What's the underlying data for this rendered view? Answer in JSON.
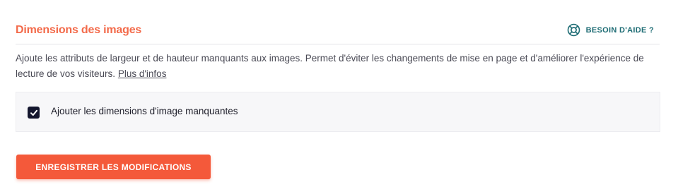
{
  "section": {
    "title": "Dimensions des images",
    "help_label": "BESOIN D'AIDE ?"
  },
  "description": {
    "text": "Ajoute les attributs de largeur et de hauteur manquants aux images. Permet d'éviter les changements de mise en page et d'améliorer l'expérience de lecture de vos visiteurs.",
    "link_label": "Plus d'infos"
  },
  "option": {
    "label": "Ajouter les dimensions d'image manquantes",
    "checked": true
  },
  "actions": {
    "save_label": "ENREGISTRER LES MODIFICATIONS"
  },
  "icons": {
    "help": "lifebuoy-icon",
    "check": "checkmark-icon"
  },
  "colors": {
    "title": "#f36a4a",
    "help": "#1c6b73",
    "button": "#f4593a",
    "checkbox": "#14162e"
  }
}
